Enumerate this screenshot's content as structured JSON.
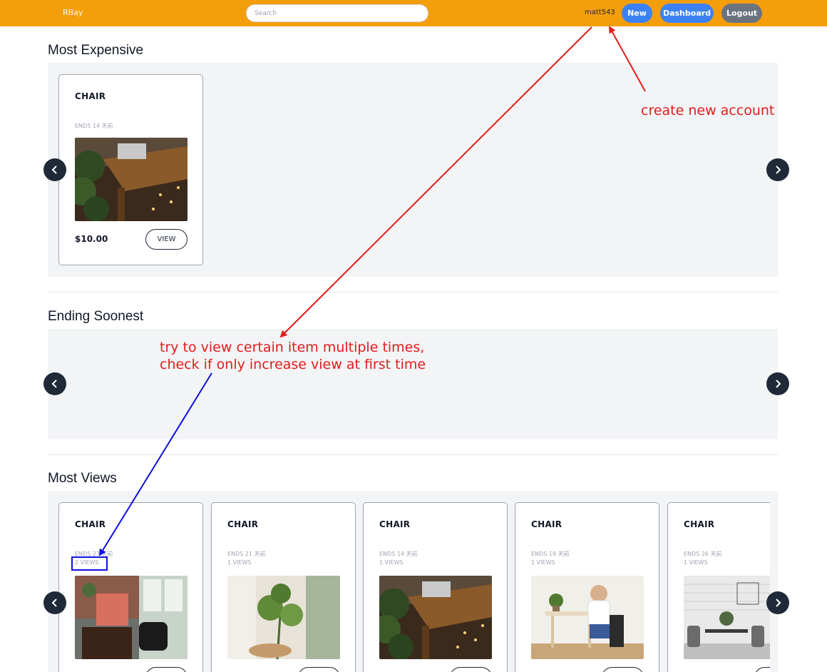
{
  "nav": {
    "brand": "RBay",
    "search_placeholder": "Search",
    "username": "matt543",
    "new_label": "New",
    "dashboard_label": "Dashboard",
    "logout_label": "Logout"
  },
  "sections": {
    "most_expensive": {
      "title": "Most Expensive",
      "cards": [
        {
          "title": "CHAIR",
          "ends": "ENDS 14 天前",
          "price": "$10.00",
          "view_label": "VIEW",
          "image": "desk-with-plants"
        }
      ]
    },
    "ending_soonest": {
      "title": "Ending Soonest"
    },
    "most_views": {
      "title": "Most Views",
      "cards": [
        {
          "title": "CHAIR",
          "ends": "ENDS 27 天前",
          "views": "2 VIEWS",
          "image": "office-with-armchair"
        },
        {
          "title": "CHAIR",
          "ends": "ENDS 21 天前",
          "views": "1 VIEWS",
          "image": "plants-by-window"
        },
        {
          "title": "CHAIR",
          "ends": "ENDS 14 天前",
          "views": "1 VIEWS",
          "image": "desk-with-plants"
        },
        {
          "title": "CHAIR",
          "ends": "ENDS 19 天前",
          "views": "1 VIEWS",
          "image": "woman-at-table"
        },
        {
          "title": "CHAIR",
          "ends": "ENDS 26 天前",
          "views": "1 VIEWS",
          "image": "white-brick-dining-room"
        }
      ]
    }
  },
  "annotations": {
    "account": "create new account",
    "views_line1": "try to view certain item multiple times,",
    "views_line2": "check if only increase view at first time"
  },
  "colors": {
    "navbar": "#f59e0b",
    "primary_button": "#3b82f6",
    "logout_button": "#6b7280",
    "annotation_red": "#e31b1b",
    "annotation_blue": "#1010e0"
  }
}
